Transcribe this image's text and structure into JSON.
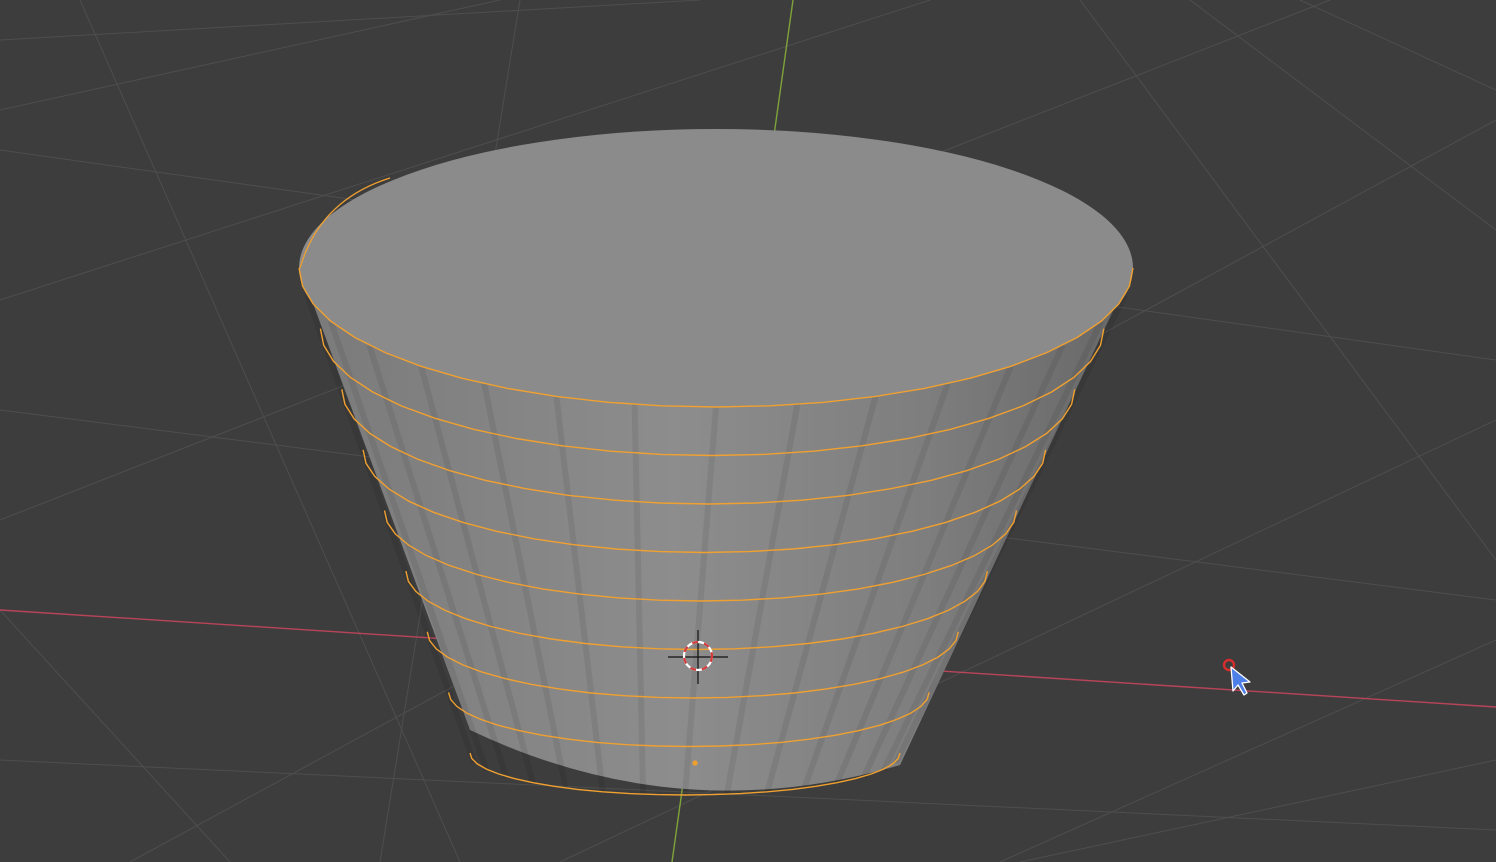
{
  "viewport": {
    "background": "#3d3d3d",
    "grid_color": "#4e4e4e",
    "x_axis_color": "#b9445a",
    "y_axis_color": "#7fa33a"
  },
  "mesh": {
    "object": "cylinder",
    "edit_mode": true,
    "top_color": "#8b8b8b",
    "side_light": "#8d8d8d",
    "side_mid": "#7e7e7e",
    "side_dark": "#676767",
    "selection_color": "#f0a030",
    "loop_cut_count": 9
  },
  "cursor3d": {
    "ring_red": "#d63a3a",
    "ring_white": "#ffffff",
    "cross_color": "#111111"
  },
  "pointer": {
    "icon": "mouse-pointer-icon",
    "color": "#4d7fe8",
    "marker_color": "#d62d2d"
  }
}
